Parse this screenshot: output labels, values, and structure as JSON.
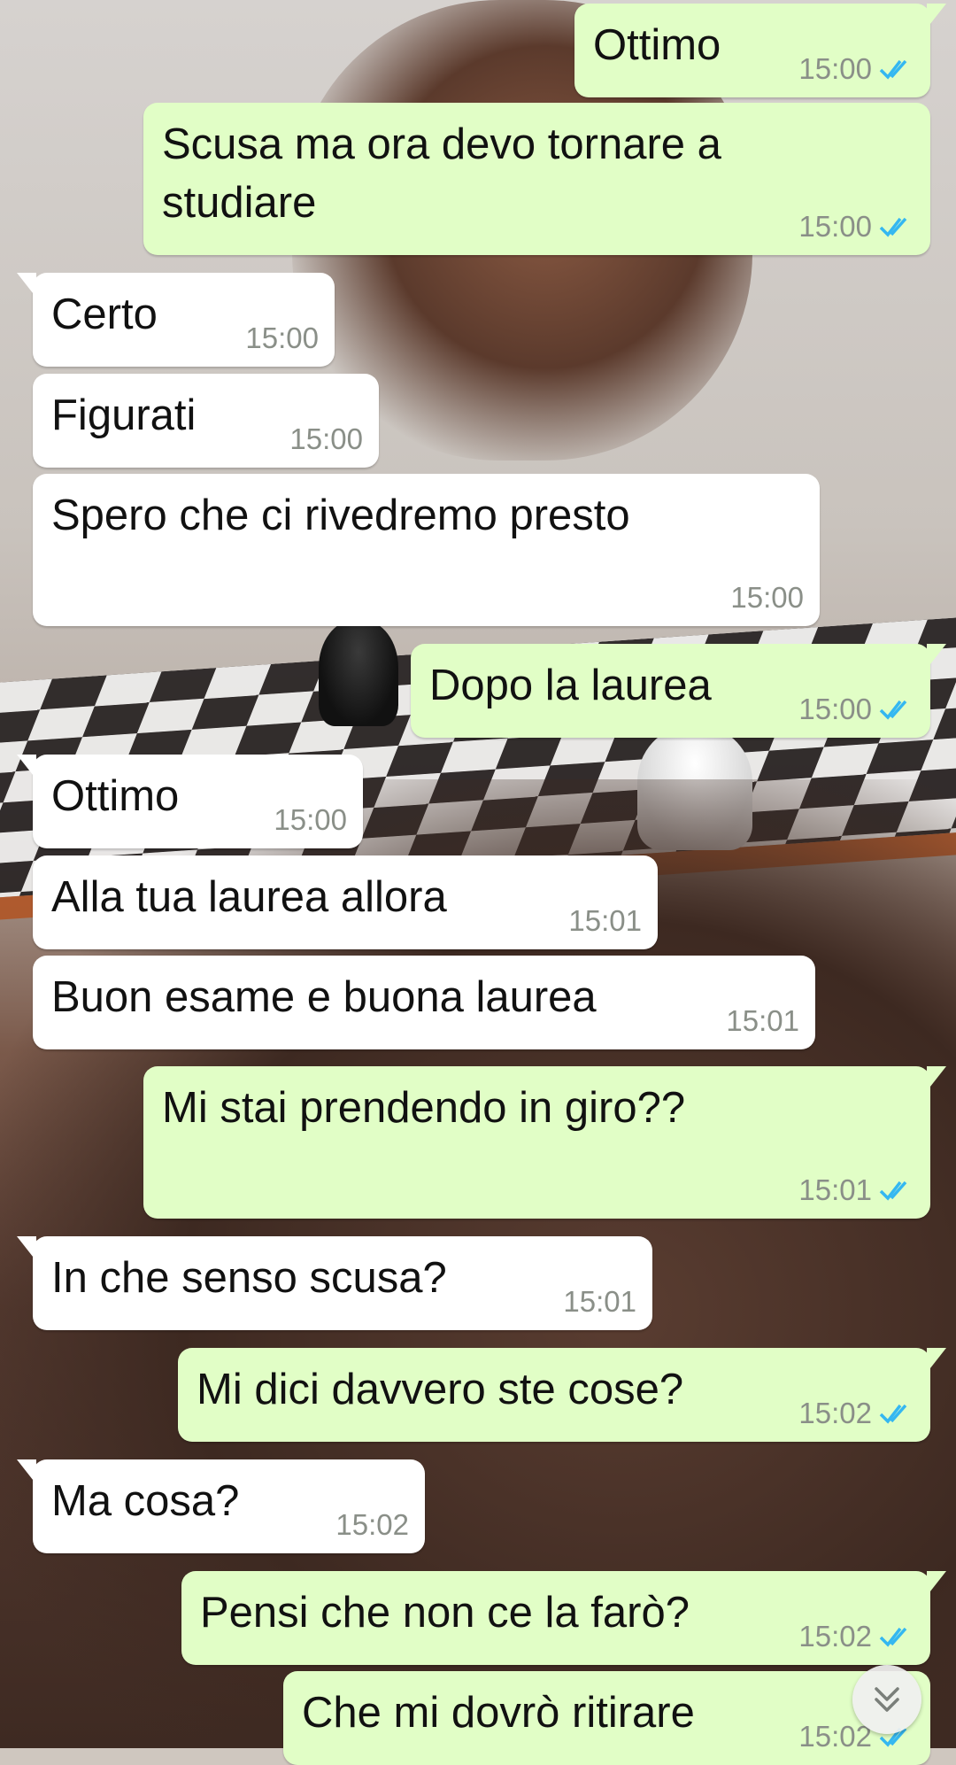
{
  "messages": [
    {
      "id": "m1",
      "direction": "outgoing",
      "text": "Ottimo",
      "time": "15:00",
      "read": true
    },
    {
      "id": "m2",
      "direction": "outgoing",
      "text": "Scusa ma ora devo tornare a\nstudiare",
      "time": "15:00",
      "read": true
    },
    {
      "id": "m3",
      "direction": "incoming",
      "text": "Certo",
      "time": "15:00"
    },
    {
      "id": "m4",
      "direction": "incoming",
      "text": "Figurati",
      "time": "15:00"
    },
    {
      "id": "m5",
      "direction": "incoming",
      "text": "Spero che ci rivedremo presto",
      "time": "15:00"
    },
    {
      "id": "m6",
      "direction": "outgoing",
      "text": "Dopo la laurea",
      "time": "15:00",
      "read": true
    },
    {
      "id": "m7",
      "direction": "incoming",
      "text": "Ottimo",
      "time": "15:00"
    },
    {
      "id": "m8",
      "direction": "incoming",
      "text": "Alla tua laurea allora",
      "time": "15:01"
    },
    {
      "id": "m9",
      "direction": "incoming",
      "text": "Buon esame e buona laurea",
      "time": "15:01"
    },
    {
      "id": "m10",
      "direction": "outgoing",
      "text": "Mi stai prendendo in giro??",
      "time": "15:01",
      "read": true
    },
    {
      "id": "m11",
      "direction": "incoming",
      "text": "In che senso scusa?",
      "time": "15:01"
    },
    {
      "id": "m12",
      "direction": "outgoing",
      "text": "Mi dici davvero ste cose?",
      "time": "15:02",
      "read": true
    },
    {
      "id": "m13",
      "direction": "incoming",
      "text": "Ma cosa?",
      "time": "15:02"
    },
    {
      "id": "m14",
      "direction": "outgoing",
      "text": "Pensi che non ce la farò?",
      "time": "15:02",
      "read": true
    },
    {
      "id": "m15",
      "direction": "outgoing",
      "text": "Che mi dovrò ritirare",
      "time": "15:02",
      "read": true
    }
  ],
  "scroll_button": {
    "icon": "double-chevron-down-icon"
  },
  "colors": {
    "outgoing_bubble": "#e1fec6",
    "incoming_bubble": "#ffffff",
    "read_ticks": "#34b7f1",
    "timestamp": "#8a8f88"
  }
}
